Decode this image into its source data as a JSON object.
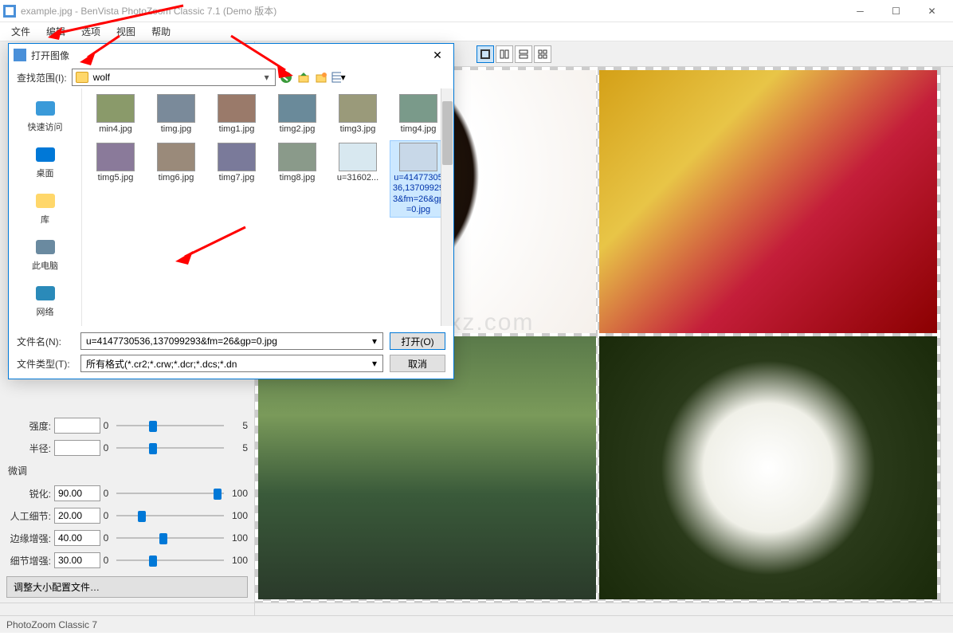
{
  "titlebar": {
    "title": "example.jpg - BenVista PhotoZoom Classic 7.1 (Demo 版本)"
  },
  "menubar": {
    "items": [
      "文件",
      "编辑",
      "选项",
      "视图",
      "帮助"
    ]
  },
  "left_panel": {
    "section1": {
      "rows": [
        {
          "label": "强度:",
          "value": "",
          "min": "0",
          "max": "5",
          "thumb_pct": 30
        },
        {
          "label": "半径:",
          "value": "",
          "min": "0",
          "max": "5",
          "thumb_pct": 30
        }
      ]
    },
    "section2_title": "微调",
    "section2": {
      "rows": [
        {
          "label": "锐化:",
          "value": "90.00",
          "min": "0",
          "max": "100",
          "thumb_pct": 90
        },
        {
          "label": "人工细节:",
          "value": "20.00",
          "min": "0",
          "max": "100",
          "thumb_pct": 20
        },
        {
          "label": "边缘增强:",
          "value": "40.00",
          "min": "0",
          "max": "100",
          "thumb_pct": 40
        },
        {
          "label": "细节增强:",
          "value": "30.00",
          "min": "0",
          "max": "100",
          "thumb_pct": 30
        }
      ]
    },
    "config_button": "调整大小配置文件…"
  },
  "dialog": {
    "title": "打开图像",
    "look_in_label": "查找范围(I):",
    "look_in_value": "wolf",
    "sidebar": [
      {
        "label": "快速访问",
        "color": "#3a9ad9"
      },
      {
        "label": "桌面",
        "color": "#0078d7"
      },
      {
        "label": "库",
        "color": "#ffd76a"
      },
      {
        "label": "此电脑",
        "color": "#6a8aa0"
      },
      {
        "label": "网络",
        "color": "#2a8ab9"
      }
    ],
    "files": [
      {
        "name": "min4.jpg",
        "selected": false
      },
      {
        "name": "timg.jpg",
        "selected": false
      },
      {
        "name": "timg1.jpg",
        "selected": false
      },
      {
        "name": "timg2.jpg",
        "selected": false
      },
      {
        "name": "timg3.jpg",
        "selected": false
      },
      {
        "name": "timg4.jpg",
        "selected": false
      },
      {
        "name": "timg5.jpg",
        "selected": false
      },
      {
        "name": "timg6.jpg",
        "selected": false
      },
      {
        "name": "timg7.jpg",
        "selected": false
      },
      {
        "name": "timg8.jpg",
        "selected": false
      },
      {
        "name": "u=31602...",
        "selected": false
      },
      {
        "name": "u=4147730536,137099293&fm=26&gp=0.jpg",
        "selected": true
      }
    ],
    "filename_label": "文件名(N):",
    "filename_value": "u=4147730536,137099293&fm=26&gp=0.jpg",
    "filetype_label": "文件类型(T):",
    "filetype_value": "所有格式(*.cr2;*.crw;*.dcr;*.dcs;*.dn",
    "open_button": "打开(O)",
    "cancel_button": "取消"
  },
  "statusbar": {
    "text": "PhotoZoom Classic 7"
  },
  "watermark": "anxz.com"
}
